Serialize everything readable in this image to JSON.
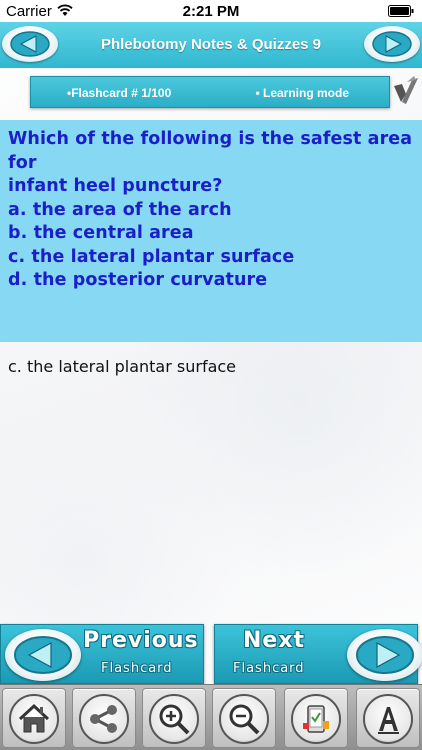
{
  "status": {
    "carrier": "Carrier",
    "time": "2:21 PM"
  },
  "header": {
    "title": "Phlebotomy Notes & Quizzes 9"
  },
  "info": {
    "flashcard": "•Flashcard #  1/100",
    "mode": "• Learning mode"
  },
  "question": {
    "lines": [
      "Which of the following is the safest area for",
      "infant heel puncture?",
      "a. the area of the arch",
      "b. the central area",
      "c. the lateral plantar surface",
      "d. the posterior curvature"
    ]
  },
  "answer": "c. the lateral plantar surface",
  "navigation": {
    "previous_main": "Previous",
    "previous_sub": "Flashcard",
    "next_main": "Next",
    "next_sub": "Flashcard"
  },
  "toolbar": {
    "icons": [
      "home-icon",
      "share-icon",
      "zoom-in-icon",
      "zoom-out-icon",
      "quiz-icon",
      "font-icon"
    ]
  },
  "colors": {
    "accent": "#2fb7d0",
    "question_bg": "#87d8f2",
    "question_text": "#1b1fc8"
  }
}
